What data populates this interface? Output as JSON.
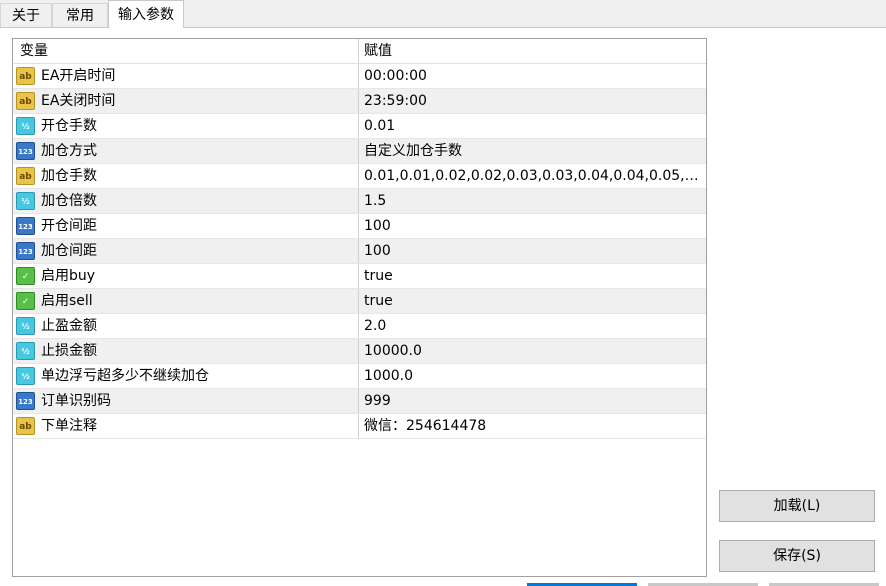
{
  "tabs": [
    {
      "label": "关于"
    },
    {
      "label": "常用"
    },
    {
      "label": "输入参数"
    }
  ],
  "table": {
    "headers": {
      "variable": "变量",
      "value": "赋值"
    },
    "rows": [
      {
        "icon": "ab",
        "name": "EA开启时间",
        "value": "00:00:00"
      },
      {
        "icon": "ab",
        "name": "EA关闭时间",
        "value": "23:59:00"
      },
      {
        "icon": "half",
        "name": "开仓手数",
        "value": "0.01"
      },
      {
        "icon": "num",
        "name": "加仓方式",
        "value": "自定义加仓手数"
      },
      {
        "icon": "ab",
        "name": "加仓手数",
        "value": "0.01,0.01,0.02,0.02,0.03,0.03,0.04,0.04,0.05,0..."
      },
      {
        "icon": "half",
        "name": "加仓倍数",
        "value": "1.5"
      },
      {
        "icon": "num",
        "name": "开仓间距",
        "value": "100"
      },
      {
        "icon": "num",
        "name": "加仓间距",
        "value": "100"
      },
      {
        "icon": "bool",
        "name": "启用buy",
        "value": "true"
      },
      {
        "icon": "bool",
        "name": "启用sell",
        "value": "true"
      },
      {
        "icon": "half",
        "name": "止盈金额",
        "value": "2.0"
      },
      {
        "icon": "half",
        "name": "止损金额",
        "value": "10000.0"
      },
      {
        "icon": "half",
        "name": "单边浮亏超多少不继续加仓",
        "value": "1000.0"
      },
      {
        "icon": "num",
        "name": "订单识别码",
        "value": "999"
      },
      {
        "icon": "ab",
        "name": "下单注释",
        "value": "微信：254614478"
      }
    ]
  },
  "icon_glyphs": {
    "ab": "ab",
    "half": "½",
    "num": "123",
    "bool": "✓"
  },
  "buttons": {
    "load": "加载(L)",
    "save": "保存(S)"
  },
  "colors": {
    "accent": "#0078d7"
  }
}
